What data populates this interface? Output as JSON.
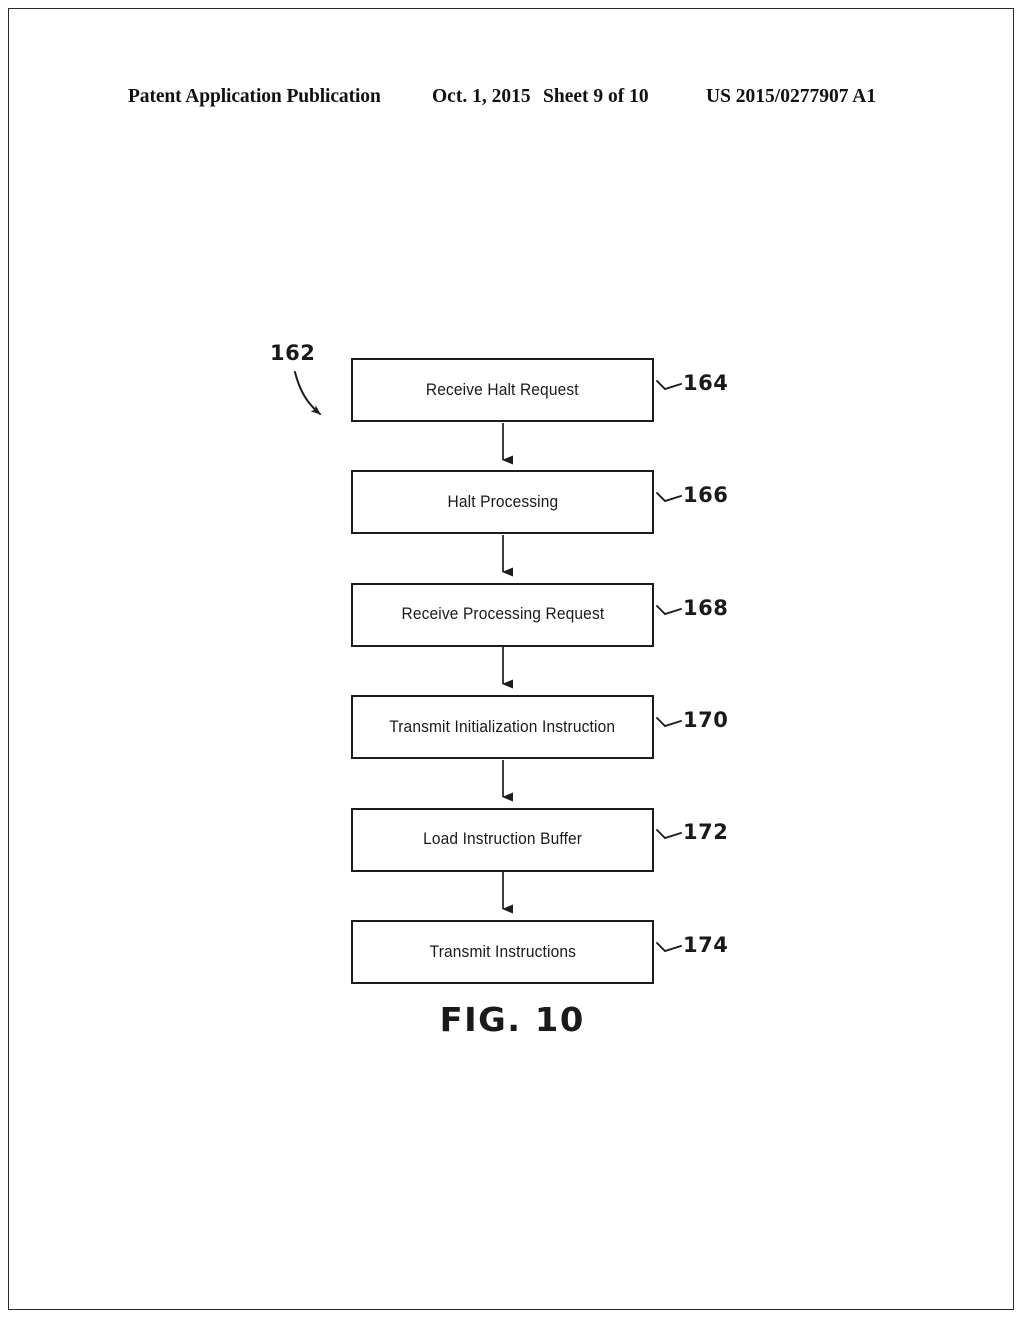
{
  "header": {
    "publication": "Patent Application Publication",
    "date": "Oct. 1, 2015",
    "sheet": "Sheet 9 of 10",
    "pub_number": "US 2015/0277907 A1"
  },
  "figure": {
    "caption": "FIG. 10",
    "overall_ref": "162",
    "type": "flowchart",
    "orientation": "vertical-top-to-bottom",
    "steps": [
      {
        "ref": "164",
        "label": "Receive Halt Request"
      },
      {
        "ref": "166",
        "label": "Halt Processing"
      },
      {
        "ref": "168",
        "label": "Receive Processing Request"
      },
      {
        "ref": "170",
        "label": "Transmit Initialization Instruction"
      },
      {
        "ref": "172",
        "label": "Load Instruction Buffer"
      },
      {
        "ref": "174",
        "label": "Transmit Instructions"
      }
    ],
    "connectors": [
      {
        "from": "164",
        "to": "166",
        "arrow": "down"
      },
      {
        "from": "166",
        "to": "168",
        "arrow": "down"
      },
      {
        "from": "168",
        "to": "170",
        "arrow": "down"
      },
      {
        "from": "170",
        "to": "172",
        "arrow": "down"
      },
      {
        "from": "172",
        "to": "174",
        "arrow": "down"
      }
    ],
    "colors": {
      "ink": "#1a1a1a",
      "paper": "#ffffff"
    }
  }
}
